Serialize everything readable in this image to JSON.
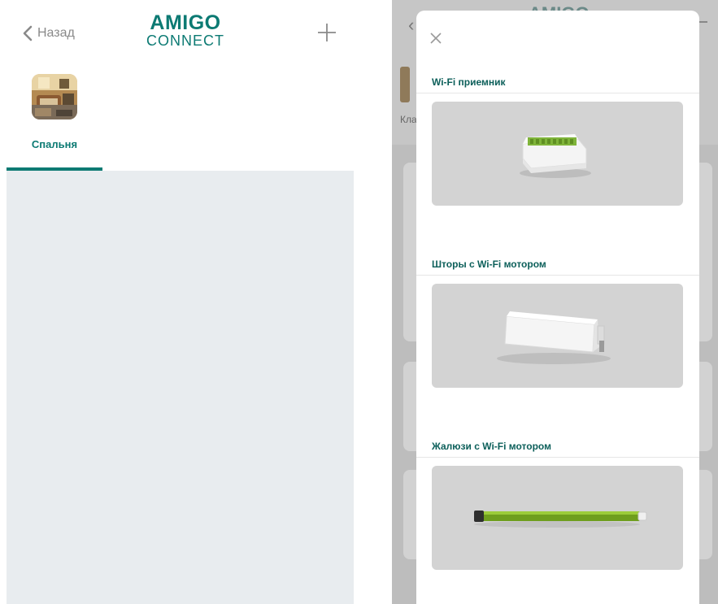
{
  "left_screen": {
    "header": {
      "back_label": "Назад",
      "logo_top": "AMIGO",
      "logo_bottom": "CONNECT",
      "add_icon": "plus-icon",
      "back_icon": "chevron-left-icon"
    },
    "rooms": [
      {
        "label": "Спальня",
        "selected": true
      }
    ],
    "colors": {
      "brand": "#0c7a73",
      "content_bg": "#e8ecef",
      "back_text": "#8a8a8a"
    }
  },
  "right_screen": {
    "modal": {
      "close_icon": "close-icon",
      "sections": [
        {
          "title": "Wi-Fi приемник",
          "image": "wifi-receiver-device"
        },
        {
          "title": "Шторы с Wi-Fi мотором",
          "image": "curtain-motor-device"
        },
        {
          "title": "Жалюзи с Wi-Fi мотором",
          "image": "tubular-blind-motor-device"
        }
      ]
    },
    "background": {
      "logo": "AMIGO",
      "room_label": "Кла"
    },
    "colors": {
      "overlay": "#bdbdbd",
      "card_bg": "#d3d3d3",
      "section_title": "#0c5f5a"
    }
  }
}
